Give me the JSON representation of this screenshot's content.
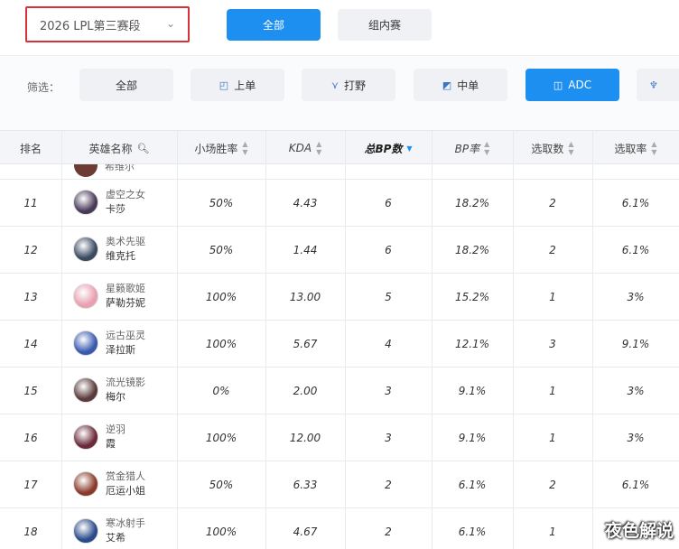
{
  "header": {
    "season_select": "2026 LPL第三赛段",
    "tabs": [
      {
        "label": "全部",
        "active": true
      },
      {
        "label": "组内赛",
        "active": false
      }
    ]
  },
  "filter": {
    "label": "筛选：",
    "options": [
      {
        "label": "全部",
        "icon": "",
        "active": false
      },
      {
        "label": "上单",
        "icon": "top-lane-icon",
        "active": false
      },
      {
        "label": "打野",
        "icon": "jungle-icon",
        "active": false
      },
      {
        "label": "中单",
        "icon": "mid-lane-icon",
        "active": false
      },
      {
        "label": "ADC",
        "icon": "adc-icon",
        "active": true
      }
    ]
  },
  "table": {
    "columns": [
      "排名",
      "英雄名称",
      "小场胜率",
      "KDA",
      "总BP数",
      "BP率",
      "选取数",
      "选取率"
    ],
    "partial_row_name": "希维尔",
    "rows": [
      {
        "rank": "11",
        "title": "虚空之女",
        "name": "卡莎",
        "win_rate": "50%",
        "kda": "4.43",
        "bp": "6",
        "bp_rate": "18.2%",
        "picks": "2",
        "pick_rate": "6.1%",
        "avatar_color": "#4a3a5a"
      },
      {
        "rank": "12",
        "title": "奥术先驱",
        "name": "维克托",
        "win_rate": "50%",
        "kda": "1.44",
        "bp": "6",
        "bp_rate": "18.2%",
        "picks": "2",
        "pick_rate": "6.1%",
        "avatar_color": "#3a4a60"
      },
      {
        "rank": "13",
        "title": "星籁歌姬",
        "name": "萨勒芬妮",
        "win_rate": "100%",
        "kda": "13.00",
        "bp": "5",
        "bp_rate": "15.2%",
        "picks": "1",
        "pick_rate": "3%",
        "avatar_color": "#e8a0b0"
      },
      {
        "rank": "14",
        "title": "远古巫灵",
        "name": "泽拉斯",
        "win_rate": "100%",
        "kda": "5.67",
        "bp": "4",
        "bp_rate": "12.1%",
        "picks": "3",
        "pick_rate": "9.1%",
        "avatar_color": "#3a5ab0"
      },
      {
        "rank": "15",
        "title": "流光镜影",
        "name": "梅尔",
        "win_rate": "0%",
        "kda": "2.00",
        "bp": "3",
        "bp_rate": "9.1%",
        "picks": "1",
        "pick_rate": "3%",
        "avatar_color": "#5a3a3a"
      },
      {
        "rank": "16",
        "title": "逆羽",
        "name": "霞",
        "win_rate": "100%",
        "kda": "12.00",
        "bp": "3",
        "bp_rate": "9.1%",
        "picks": "1",
        "pick_rate": "3%",
        "avatar_color": "#6a2a3a"
      },
      {
        "rank": "17",
        "title": "赏金猎人",
        "name": "厄运小姐",
        "win_rate": "50%",
        "kda": "6.33",
        "bp": "2",
        "bp_rate": "6.1%",
        "picks": "2",
        "pick_rate": "6.1%",
        "avatar_color": "#8a3a2a"
      },
      {
        "rank": "18",
        "title": "寒冰射手",
        "name": "艾希",
        "win_rate": "100%",
        "kda": "4.67",
        "bp": "2",
        "bp_rate": "6.1%",
        "picks": "1",
        "pick_rate": "",
        "avatar_color": "#2a4a8a"
      }
    ]
  },
  "watermark": "夜色解说"
}
